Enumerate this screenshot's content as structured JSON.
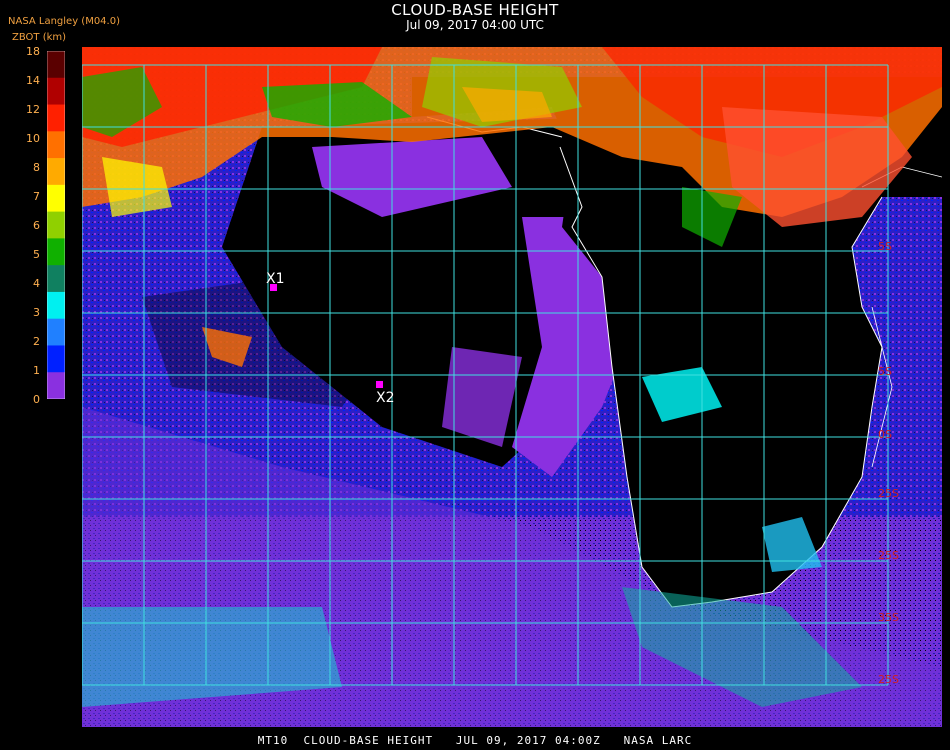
{
  "header": {
    "provider": "NASA Langley (M04.0)",
    "title": "CLOUD-BASE HEIGHT",
    "subtitle": "Jul 09, 2017 04:00 UTC",
    "unit_label": "ZBOT (km)"
  },
  "legend": {
    "ticks": [
      "18",
      "14",
      "12",
      "10",
      "8",
      "7",
      "6",
      "5",
      "4",
      "3",
      "2",
      "1",
      "0"
    ],
    "colors": [
      "#5a0000",
      "#b00000",
      "#ff2000",
      "#ff7000",
      "#ffaa00",
      "#ffff00",
      "#90d000",
      "#10b000",
      "#108060",
      "#00f0f0",
      "#2080ff",
      "#0020ff",
      "#8a30e0"
    ]
  },
  "markers": [
    {
      "id": "X1",
      "label": "X1",
      "color": "#ff00ff"
    },
    {
      "id": "X2",
      "label": "X2",
      "color": "#ff00ff"
    }
  ],
  "grid_labels": [
    "5S",
    "5S",
    "0S",
    "25S",
    "25S",
    "35S",
    "25S"
  ],
  "colors": {
    "grid": "#40e0e0",
    "coast": "#ffffff",
    "label_red": "#d02020",
    "land_purple": "#8a30e0"
  },
  "footer": {
    "text": "MT10  CLOUD-BASE HEIGHT   JUL 09, 2017 04:00Z   NASA LARC"
  }
}
